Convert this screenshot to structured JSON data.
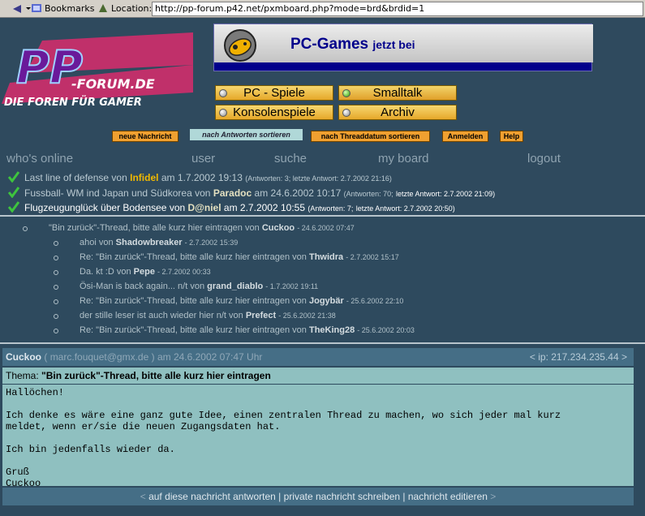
{
  "browser": {
    "bookmarks_label": "Bookmarks",
    "location_label": "Location:",
    "url": "http://pp-forum.p42.net/pxmboard.php?mode=brd&brdid=1"
  },
  "logo": {
    "big": "PP",
    "forum": "-FORUM.DE",
    "tagline": "DIE FOREN FÜR GAMER"
  },
  "banner": {
    "title": "PC-Games",
    "suffix": "jetzt bei"
  },
  "boards": [
    {
      "label": "PC - Spiele",
      "active": false
    },
    {
      "label": "Smalltalk",
      "active": true
    },
    {
      "label": "Konsolenspiele",
      "active": false
    },
    {
      "label": "Archiv",
      "active": false
    }
  ],
  "actions": {
    "new_message": "neue Nachricht",
    "sort_answers": "nach Antworten sortieren",
    "sort_date": "nach Threaddatum sortieren",
    "login": "Anmelden",
    "help": "Help"
  },
  "nav": {
    "who_online": "who's online",
    "user": "user",
    "search": "suche",
    "my_board": "my board",
    "logout": "logout"
  },
  "threads": [
    {
      "title": "Last line of defense",
      "by": "von",
      "author": "Infidel",
      "at": "am",
      "date": "1.7.2002 19:13",
      "meta": "(Antworten: 3; letzte Antwort: 2.7.2002 21:16)"
    },
    {
      "title": "Fussball- WM ind Japan und Südkorea",
      "by": "von",
      "author": "Paradoc",
      "at": "am",
      "date": "24.6.2002 10:17",
      "meta_a": "(Antworten: 70;",
      "meta_b": "letzte Antwort: 2.7.2002 21:09)"
    },
    {
      "title": "Flugzeugunglück über Bodensee",
      "by": "von",
      "author": "D@niel",
      "at": "am",
      "date": "2.7.2002 10:55",
      "meta_a": "(Antworten: 7;",
      "meta_b": "letzte Antwort: 2.7.2002 20:50)"
    }
  ],
  "tree": [
    {
      "subject": "\"Bin zurück\"-Thread, bitte alle kurz hier eintragen",
      "by": "von",
      "author": "Cuckoo",
      "date": "- 24.6.2002 07:47"
    },
    {
      "subject": "ahoi",
      "by": "von",
      "author": "Shadowbreaker",
      "date": "- 2.7.2002 15:39"
    },
    {
      "subject": "Re: \"Bin zurück\"-Thread, bitte alle kurz hier eintragen",
      "by": "von",
      "author": "Thwidra",
      "date": "- 2.7.2002 15:17"
    },
    {
      "subject": "Da. kt :D",
      "by": "von",
      "author": "Pepe",
      "date": "- 2.7.2002 00:33"
    },
    {
      "subject": "Ösi-Man is back again... n/t",
      "by": "von",
      "author": "grand_diablo",
      "date": "- 1.7.2002 19:11"
    },
    {
      "subject": "Re: \"Bin zurück\"-Thread, bitte alle kurz hier eintragen",
      "by": "von",
      "author": "Jogybär",
      "date": "- 25.6.2002 22:10"
    },
    {
      "subject": "der stille leser ist auch wieder hier n/t",
      "by": "von",
      "author": "Prefect",
      "date": "- 25.6.2002 21:38"
    },
    {
      "subject": "Re: \"Bin zurück\"-Thread, bitte alle kurz hier eintragen",
      "by": "von",
      "author": "TheKing28",
      "date": "- 25.6.2002 20:03"
    }
  ],
  "message": {
    "author": "Cuckoo",
    "email": "( marc.fouquet@gmx.de )",
    "date": "am 24.6.2002 07:47 Uhr",
    "ip": "< ip: 217.234.235.44 >",
    "thema_label": "Thema:",
    "subject": "\"Bin zurück\"-Thread, bitte alle kurz hier eintragen",
    "body": "Hallöchen!\n\nIch denke es wäre eine ganz gute Idee, einen zentralen Thread zu machen, wo sich jeder mal kurz\nmeldet, wenn er/sie die neuen Zugangsdaten hat.\n\nIch bin jedenfalls wieder da.\n\nGruß\nCuckoo",
    "reply": "auf diese nachricht antworten",
    "private": "private nachricht schreiben",
    "edit": "nachricht editieren",
    "sep": "|",
    "lt": "<",
    "gt": ">"
  },
  "colors": {
    "bg": "#2e4a5e",
    "accent": "#f0b800",
    "msg_bg": "#8fc0c0",
    "header": "#456e86"
  }
}
